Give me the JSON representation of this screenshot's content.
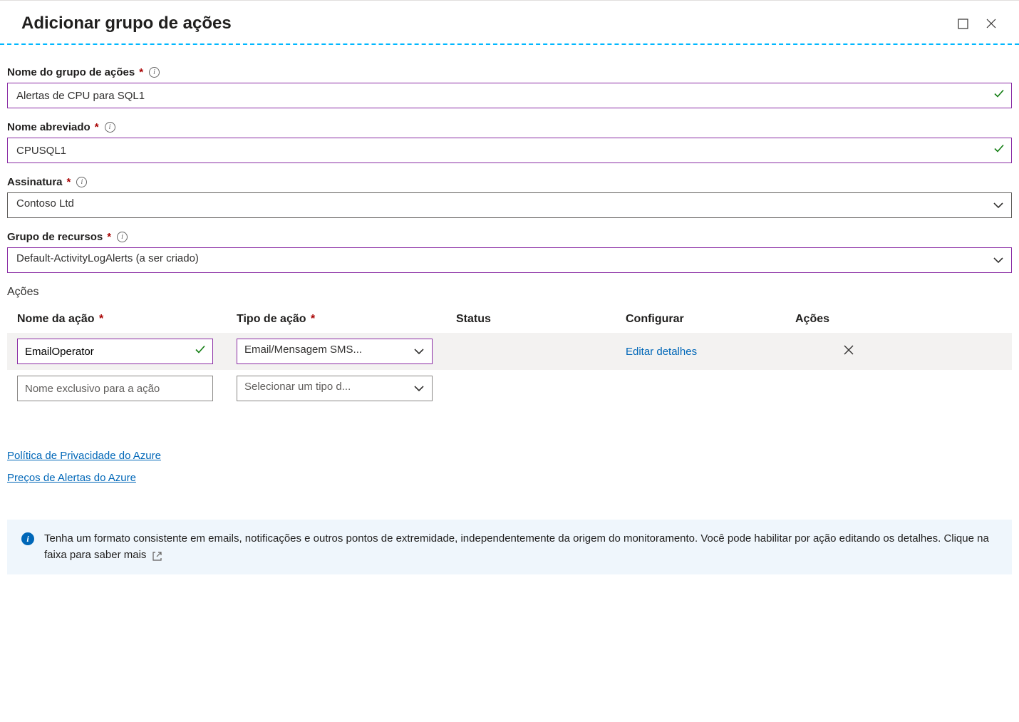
{
  "header": {
    "title": "Adicionar grupo de ações"
  },
  "fields": {
    "group_name": {
      "label": "Nome do grupo de ações",
      "value": "Alertas de CPU para SQL1"
    },
    "short_name": {
      "label": "Nome abreviado",
      "value": "CPUSQL1"
    },
    "subscription": {
      "label": "Assinatura",
      "value": "Contoso Ltd"
    },
    "resource_group": {
      "label": "Grupo de recursos",
      "value": "Default-ActivityLogAlerts (a ser criado)"
    }
  },
  "actions": {
    "section_label": "Ações",
    "columns": {
      "name": "Nome da ação",
      "type": "Tipo de ação",
      "status": "Status",
      "configure": "Configurar",
      "actions": "Ações"
    },
    "rows": [
      {
        "name_value": "EmailOperator",
        "type_value": "Email/Mensagem SMS...",
        "configure_label": "Editar detalhes"
      }
    ],
    "empty_row": {
      "name_placeholder": "Nome exclusivo para a ação",
      "type_placeholder": "Selecionar um tipo d..."
    }
  },
  "links": {
    "privacy": "Política de Privacidade do Azure",
    "pricing": "Preços de Alertas do Azure"
  },
  "banner": {
    "text": "Tenha um formato consistente em emails, notificações e outros pontos de extremidade, independentemente da origem do monitoramento. Você pode habilitar por ação editando os detalhes. Clique na faixa para saber mais"
  }
}
